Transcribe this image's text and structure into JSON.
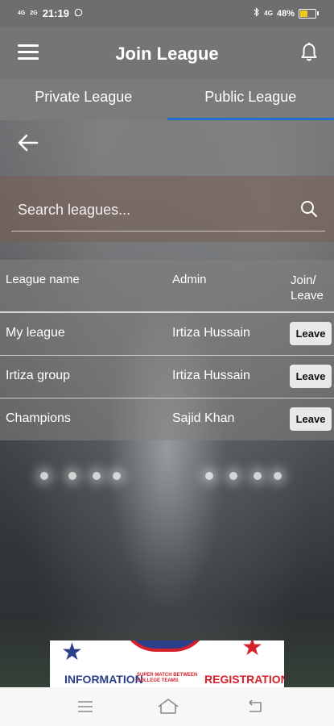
{
  "status_bar": {
    "signal_1": "4G",
    "signal_2": "2G",
    "time": "21:19",
    "network": "4G",
    "battery": "48%",
    "battery_level": 0.48
  },
  "header": {
    "title": "Join League"
  },
  "tabs": [
    {
      "label": "Private League",
      "active": false
    },
    {
      "label": "Public League",
      "active": true
    }
  ],
  "search": {
    "placeholder": "Search leagues...",
    "value": ""
  },
  "table": {
    "columns": {
      "name": "League name",
      "admin": "Admin",
      "join_line1": "Join/",
      "join_line2": "Leave"
    },
    "rows": [
      {
        "name": "My league",
        "admin": "Irtiza Hussain",
        "action": "Leave"
      },
      {
        "name": "Irtiza group",
        "admin": "Irtiza Hussain",
        "action": "Leave"
      },
      {
        "name": "Champions",
        "admin": "Sajid Khan",
        "action": "Leave"
      }
    ]
  },
  "ad": {
    "left_text": "INFORMATION",
    "middle_text": "SUPER MATCH BETWEEN COLLEGE TEAMS",
    "right_text": "REGISTRATION"
  },
  "colors": {
    "header_bg": "#757575",
    "tab_indicator": "#1f6fd1",
    "battery_fill": "#f5c518"
  },
  "icons": {
    "menu": "menu-icon",
    "notifications": "bell-icon",
    "back": "arrow-left-icon",
    "search": "search-icon",
    "nav_menu": "menu-icon",
    "nav_home": "home-icon",
    "nav_back": "back-icon"
  }
}
